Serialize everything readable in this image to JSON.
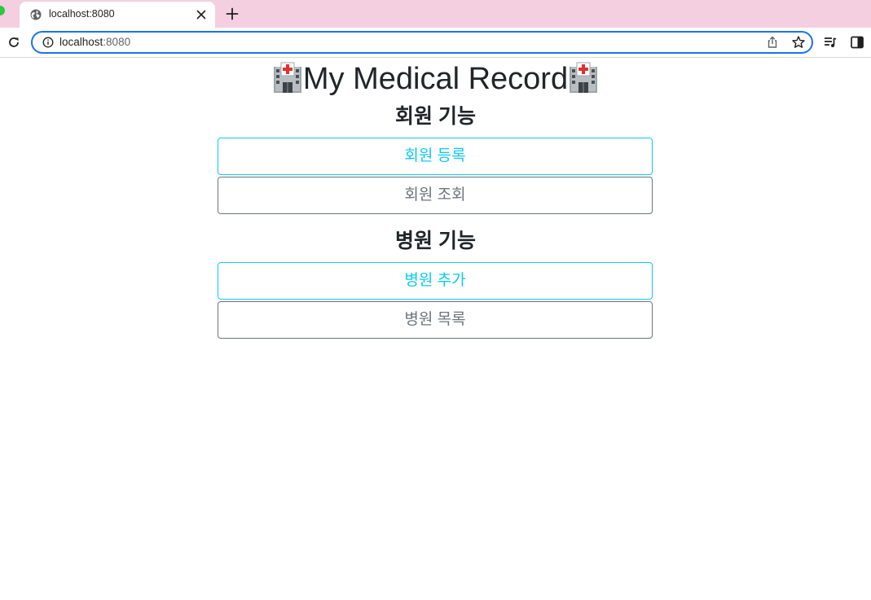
{
  "browser": {
    "tab_title": "localhost:8080",
    "url_host": "localhost",
    "url_port": ":8080",
    "icons": [
      "globe-icon",
      "close-icon",
      "plus-icon",
      "reload-icon",
      "info-icon",
      "share-icon",
      "star-icon",
      "media-icon",
      "side-panel-icon"
    ]
  },
  "page": {
    "title": "My Medical Record",
    "title_icon": "hospital-icon",
    "member_section": {
      "heading": "회원 기능",
      "register_label": "회원 등록",
      "lookup_label": "회원 조회"
    },
    "hospital_section": {
      "heading": "병원 기능",
      "add_label": "병원 추가",
      "list_label": "병원 목록"
    }
  },
  "colors": {
    "tabstrip": "#f4cfe0",
    "accent_info": "#0dcaf0",
    "secondary": "#6c757d",
    "focus_ring": "#1a73e8"
  }
}
